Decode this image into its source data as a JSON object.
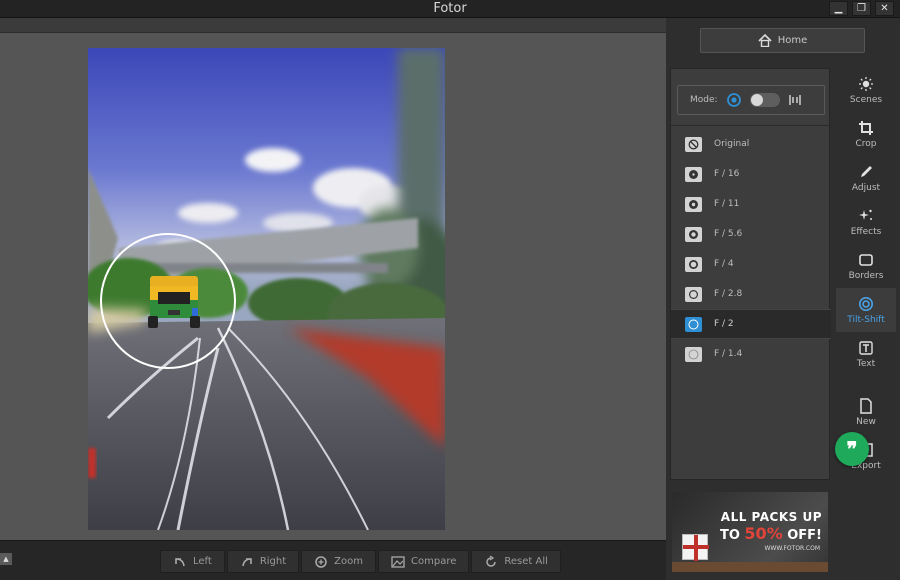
{
  "app": {
    "title": "Fotor"
  },
  "window_controls": {
    "minimize": "▁",
    "restore": "❐",
    "close": "✕"
  },
  "toolbar": {
    "items": [
      {
        "label": "Left",
        "icon": "rotate-left-icon"
      },
      {
        "label": "Right",
        "icon": "rotate-right-icon"
      },
      {
        "label": "Zoom",
        "icon": "zoom-icon"
      },
      {
        "label": "Compare",
        "icon": "compare-icon"
      },
      {
        "label": "Reset All",
        "icon": "reset-icon"
      }
    ]
  },
  "home": {
    "label": "Home",
    "icon": "home-icon"
  },
  "tilt_shift": {
    "mode_label": "Mode:",
    "mode_left_icon": "radial-mode-icon",
    "mode_right_icon": "linear-mode-icon",
    "presets": [
      {
        "label": "Original",
        "active": false
      },
      {
        "label": "F / 16",
        "active": false
      },
      {
        "label": "F / 11",
        "active": false
      },
      {
        "label": "F / 5.6",
        "active": false
      },
      {
        "label": "F / 4",
        "active": false
      },
      {
        "label": "F / 2.8",
        "active": false
      },
      {
        "label": "F / 2",
        "active": true
      },
      {
        "label": "F / 1.4",
        "active": false
      }
    ]
  },
  "ad": {
    "line1": "ALL PACKS UP",
    "line2_pre": "TO ",
    "line2_highlight": "50%",
    "line2_post": " OFF!",
    "url": "WWW.FOTOR.COM"
  },
  "sidenav": {
    "items": [
      {
        "label": "Scenes",
        "icon": "sun-icon"
      },
      {
        "label": "Crop",
        "icon": "crop-icon"
      },
      {
        "label": "Adjust",
        "icon": "pencil-icon"
      },
      {
        "label": "Effects",
        "icon": "sparkle-icon"
      },
      {
        "label": "Borders",
        "icon": "border-icon"
      },
      {
        "label": "Tilt-Shift",
        "icon": "tilt-shift-icon",
        "active": true
      },
      {
        "label": "Text",
        "icon": "text-icon"
      }
    ],
    "bottom": [
      {
        "label": "New",
        "icon": "new-file-icon"
      },
      {
        "label": "Export",
        "icon": "export-icon"
      }
    ]
  },
  "colors": {
    "accent": "#2e8fd4",
    "fab": "#1faa5b"
  }
}
